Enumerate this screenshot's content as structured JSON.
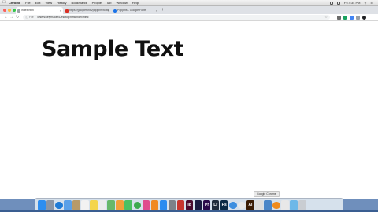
{
  "menubar": {
    "menus": [
      "Chrome",
      "File",
      "Edit",
      "View",
      "History",
      "Bookmarks",
      "People",
      "Tab",
      "Window",
      "Help"
    ],
    "clock": "Fri 4:34 PM"
  },
  "tabs": [
    {
      "label": "index.html",
      "favicon_color": "#9aa0a6",
      "active": true
    },
    {
      "label": "https://googlefonts/poppins/fonts",
      "favicon_color": "#d93025",
      "active": false
    },
    {
      "label": "Poppins - Google Fonts",
      "favicon_color": "#1a73e8",
      "active": false
    }
  ],
  "toolbar": {
    "back_icon": "back-arrow-icon",
    "forward_icon": "forward-arrow-icon",
    "reload_icon": "reload-icon",
    "protocol": "File",
    "url": "/Users/kelymaker/Desktop/html/index.html"
  },
  "page": {
    "heading": "Sample Text"
  },
  "tooltip": {
    "text": "Google Chrome"
  },
  "dock": {
    "apps": [
      {
        "name": "finder-icon",
        "color": "#2d8ef0",
        "label": ""
      },
      {
        "name": "launchpad-icon",
        "color": "#8a95a5",
        "label": ""
      },
      {
        "name": "safari-icon",
        "color": "#1f7bd6",
        "label": ""
      },
      {
        "name": "mail-icon",
        "color": "#5aa0e8",
        "label": ""
      },
      {
        "name": "contacts-icon",
        "color": "#b79a68",
        "label": ""
      },
      {
        "name": "calendar-icon",
        "color": "#f2f2f2",
        "label": ""
      },
      {
        "name": "notes-icon",
        "color": "#f4d54a",
        "label": ""
      },
      {
        "name": "reminders-icon",
        "color": "#ececec",
        "label": ""
      },
      {
        "name": "maps-icon",
        "color": "#67b86a",
        "label": ""
      },
      {
        "name": "photos-icon",
        "color": "#f2a03a",
        "label": ""
      },
      {
        "name": "messages-icon",
        "color": "#4cc063",
        "label": ""
      },
      {
        "name": "facetime-icon",
        "color": "#3caa4f",
        "label": ""
      },
      {
        "name": "itunes-icon",
        "color": "#e04b8d",
        "label": ""
      },
      {
        "name": "ibooks-icon",
        "color": "#f08a24",
        "label": ""
      },
      {
        "name": "app-store-icon",
        "color": "#2b8cf0",
        "label": ""
      },
      {
        "name": "system-preferences-icon",
        "color": "#7c8189",
        "label": ""
      },
      {
        "name": "photo-booth-icon",
        "color": "#c7362f",
        "label": ""
      },
      {
        "name": "indesign-icon",
        "color": "#4a0a2e",
        "label": "Id"
      },
      {
        "name": "media-encoder-icon",
        "color": "#1a1a40",
        "label": ""
      },
      {
        "name": "premiere-icon",
        "color": "#2a0a4a",
        "label": "Pr"
      },
      {
        "name": "lightroom-icon",
        "color": "#1f2b3a",
        "label": "Lr"
      },
      {
        "name": "photoshop-icon",
        "color": "#0a2a45",
        "label": "Ps"
      },
      {
        "name": "dropbox-icon",
        "color": "#3d8fe0",
        "label": ""
      },
      {
        "name": "chrome-icon",
        "color": "#e9e9e9",
        "label": ""
      },
      {
        "name": "illustrator-icon",
        "color": "#3a1c05",
        "label": "Ai"
      },
      {
        "name": "quicktime-icon",
        "color": "#dcdcdc",
        "label": ""
      },
      {
        "name": "scripteditor-icon",
        "color": "#4a86c8",
        "label": ""
      },
      {
        "name": "vlc-icon",
        "color": "#f08b1c",
        "label": ""
      },
      {
        "name": "text-editor-icon",
        "color": "#e8e8e8",
        "label": ""
      },
      {
        "name": "downloads-folder-icon",
        "color": "#6db8e8",
        "label": ""
      },
      {
        "name": "trash-icon",
        "color": "#c9cdd2",
        "label": ""
      }
    ]
  }
}
